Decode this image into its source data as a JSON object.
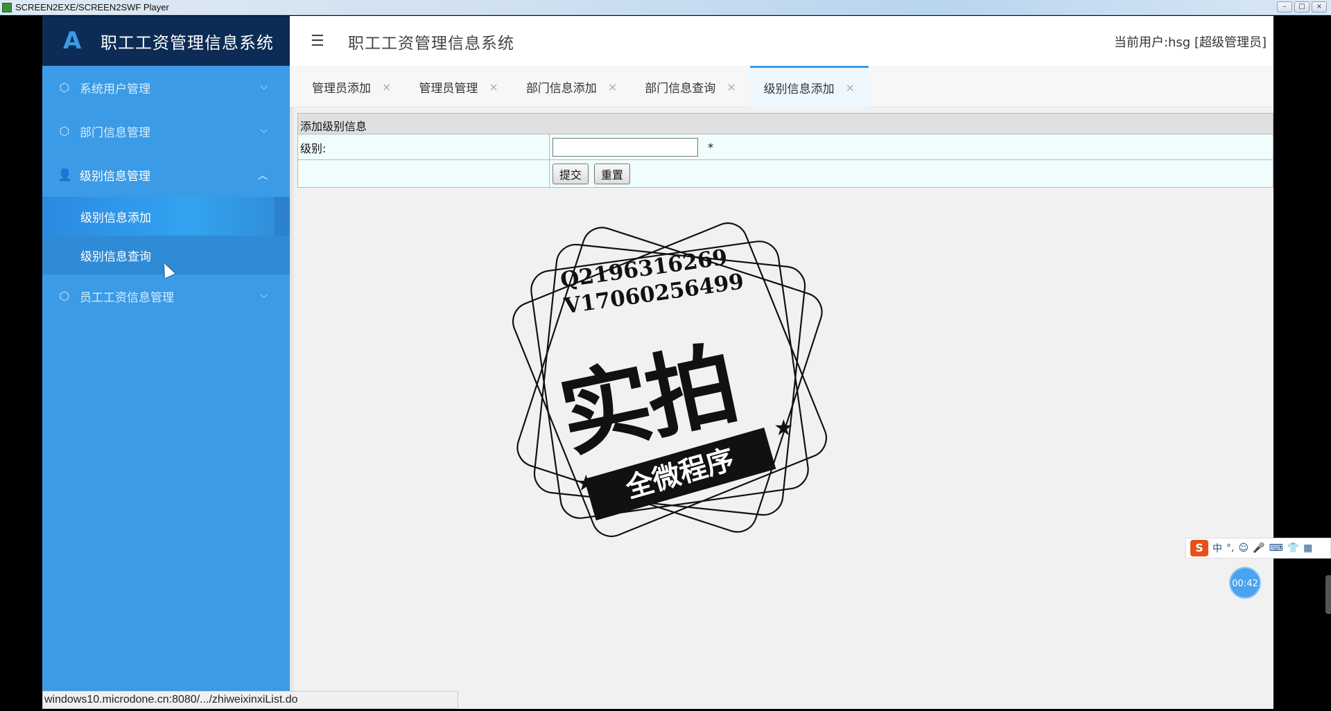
{
  "window": {
    "title": "SCREEN2EXE/SCREEN2SWF Player",
    "buttons": [
      "–",
      "□",
      "×"
    ]
  },
  "sidebar": {
    "logo_icon": "A",
    "system_name": "职工工资管理信息系统",
    "items": [
      {
        "label": "系统用户管理",
        "icon": "cube-icon",
        "glyph": "⬡",
        "chevron": "⌵"
      },
      {
        "label": "部门信息管理",
        "icon": "cube-icon",
        "glyph": "⬡",
        "chevron": "⌵"
      },
      {
        "label": "级别信息管理",
        "icon": "user-icon",
        "glyph": "👤",
        "chevron": "︿",
        "children": [
          {
            "label": "级别信息添加"
          },
          {
            "label": "级别信息查询"
          }
        ]
      },
      {
        "label": "员工工资信息管理",
        "icon": "cube-icon",
        "glyph": "⬡",
        "chevron": "⌵"
      }
    ]
  },
  "header": {
    "menu_icon": "☰",
    "title": "职工工资管理信息系统",
    "current_user": "当前用户:hsg [超级管理员]"
  },
  "tabs": [
    {
      "label": "管理员添加",
      "close": "×"
    },
    {
      "label": "管理员管理",
      "close": "×"
    },
    {
      "label": "部门信息添加",
      "close": "×"
    },
    {
      "label": "部门信息查询",
      "close": "×"
    },
    {
      "label": "级别信息添加",
      "close": "×",
      "active": true
    }
  ],
  "form": {
    "title": "添加级别信息",
    "level_label": "级别:",
    "level_value": "",
    "required_mark": "*",
    "submit_label": "提交",
    "reset_label": "重置"
  },
  "watermark": {
    "line1": "Q2196316269",
    "line2": "V17060256499",
    "big_text": "实拍",
    "ribbon_text": "全微程序",
    "star": "★"
  },
  "ime": {
    "logo": "S",
    "mode": "中",
    "punct": "°,",
    "icons": [
      "☺",
      "🎤",
      "⌨",
      "👕",
      "▦"
    ]
  },
  "timer": "00:42",
  "status_url": "windows10.microdone.cn:8080/.../zhiweixinxiList.do",
  "colors": {
    "sidebar": "#3b9be6",
    "brand_bar": "#0d2c55",
    "active_tab_border": "#3b9be6"
  }
}
